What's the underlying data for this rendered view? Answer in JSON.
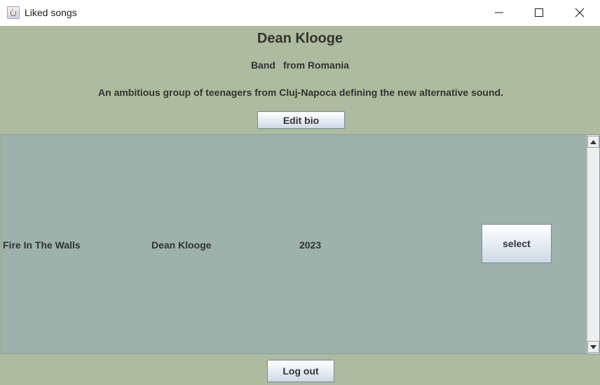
{
  "window": {
    "title": "Liked songs",
    "icon": "java-cup-icon",
    "controls": [
      "minimize-icon",
      "maximize-icon",
      "close-icon"
    ]
  },
  "artist": {
    "name": "Dean Klooge",
    "type": "Band",
    "origin": "from Romania",
    "bio": "An ambitious group of teenagers from Cluj-Napoca defining the new alternative sound.",
    "edit_bio_label": "Edit bio"
  },
  "songs": [
    {
      "title": "Fire In The Walls",
      "artist": "Dean Klooge",
      "year": "2023",
      "select_label": "select"
    }
  ],
  "footer": {
    "logout_label": "Log out"
  },
  "colors": {
    "panel_bg": "#adbb9e",
    "list_bg": "#9cb2aa",
    "text": "#333333"
  }
}
